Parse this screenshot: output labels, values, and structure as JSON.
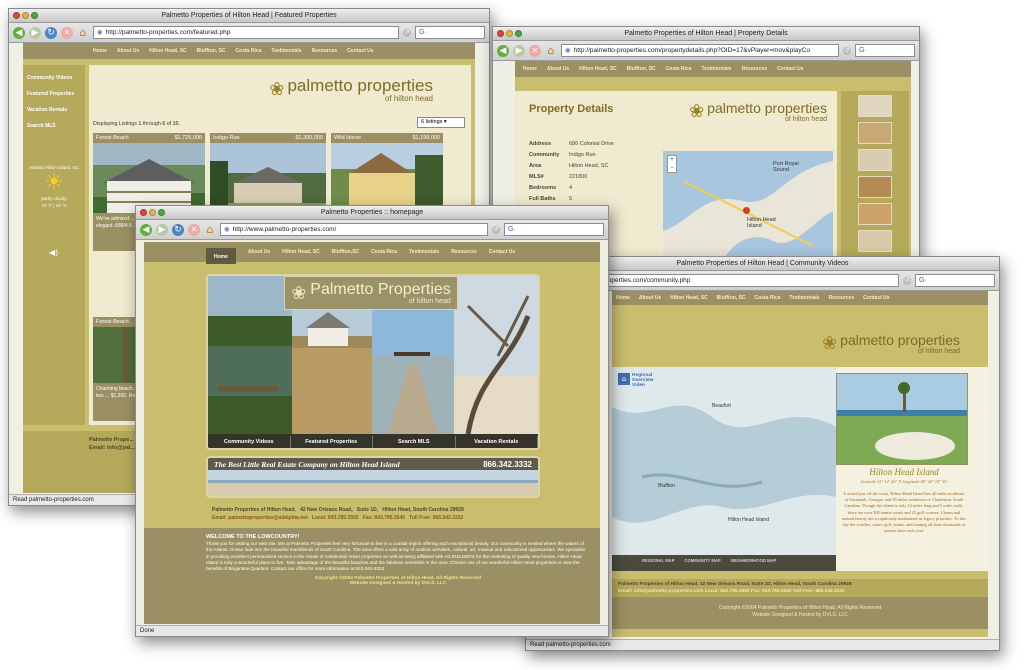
{
  "brand": {
    "name": "palmetto properties",
    "sub": "of hilton head",
    "home_title": "Palmetto Properties",
    "palm_glyph": "❀",
    "color_olive": "#c9bd6e",
    "color_nav": "#9b9063"
  },
  "nav": [
    "Home",
    "About Us",
    "Hilton Head, SC",
    "Bluffton, SC",
    "Costa Rica",
    "Testimonials",
    "Resources",
    "Contact Us"
  ],
  "nav_home": [
    "About Us",
    "Hilton Head, SC",
    "Bluffton,SC",
    "Costa Rica",
    "Testimonials",
    "Resources",
    "Contact Us"
  ],
  "nav_home_tab": "Home",
  "w1": {
    "title": "Palmetto Properties of Hilton Head | Featured Properties",
    "url": "http://palmetto-properties.com/featured.php",
    "status": "Read palmetto-properties.com",
    "sidebar": [
      "Community Videos",
      "Featured Properties",
      "Vacation Rentals",
      "Search MLS"
    ],
    "weather_title": "Atlantic Hilton Island, SC",
    "weather_label": "partly cloudy",
    "weather_temps": "74 °F | 24 °C",
    "listing_text": "Displaying Listings",
    "listing_from": "1",
    "listing_through": "through",
    "listing_to": "6",
    "listing_of": "of",
    "listing_total": "10.",
    "listings_select": "6 listings",
    "cards": [
      {
        "name": "Forest Beach",
        "price": "$1,725,000"
      },
      {
        "name": "Indigo Run",
        "price": "$1,300,000"
      },
      {
        "name": "Wild Horse",
        "price": "$1,199,000"
      }
    ],
    "card_text": "We've admired ... years with it's ... & view of ... elegant. 688/4.5 ...",
    "card2_name": "Forest Beach",
    "card2_text": "Charming beach... ocean home in ... bedroom, two ... $1,300. Room fo...",
    "footer_name": "Palmetto Prope...",
    "footer_email": "Email: info@pal..."
  },
  "w2": {
    "title": "Palmetto Properties of Hilton Head | Property Details",
    "url": "http://palmetto-properties.com/propertydetails.php?OID=17&vPlayer=mov&playCo",
    "heading": "Property Details",
    "details": [
      {
        "label": "Address",
        "value": "686 Colonial Drive"
      },
      {
        "label": "Community",
        "value": "Indigo Run"
      },
      {
        "label": "Area",
        "value": "Hilton Head, SC"
      },
      {
        "label": "MLS#",
        "value": "221800"
      },
      {
        "label": "Bedrooms",
        "value": "4"
      },
      {
        "label": "Full Baths",
        "value": "5"
      }
    ],
    "map_label_1": "Port Royal Sound",
    "map_label_2": "Hilton Head Island"
  },
  "w3": {
    "title": "Palmetto Properties :: homepage",
    "url": "http://www.palmetto-properties.com/",
    "status": "Done",
    "menu": [
      "Community Videos",
      "Featured Properties",
      "Search MLS",
      "Vacation Rentals"
    ],
    "tagline": "The Best Little Real Estate Company on Hilton Head Island",
    "phone": "866.342.3332",
    "address_line": "Palmetto Properties of Hilton Head,   42 New Orleans Road,   Suite 1D,   Hilton Head, South Carolina 29928",
    "contact_line": "Email: palmettoproperties@adelphia.net   Local: 843.785.3505   Fax: 843.785.3540   Toll Free: 866.342.3332",
    "welcome_title": "WELCOME TO THE LOWCOUNTRY!",
    "welcome_body": "Thank you for visiting our web site. We at Palmetto Properties feel very fortunate to live in a coastal region offering such exceptional beauty. Our community is nestled where the waters of the Atlantic Ocean fade into the beautiful marshlands of South Carolina. The area offers a vast array of outdoor activities, cultural, art, musical and educational opportunities. We specialize in providing excellent personalized service in the resale of residential/ resort properties as well as being affiliated with H2 BUILDERS for the marketing of quality new homes. Hilton Head Island is truly a wonderful place to live. Take advantage of the beautiful beaches and the fabulous amenities in the area. Choose one of our wonderful Hilton Head properties or view the benefits of Brigantine Quarters. Contact our office for more information at 843-342-3332.",
    "copyright": "Copyright ©2004 Palmetto Properties of Hilton Head.  All Rights Reserved",
    "credit": "Website Designed & Hosted by DVLS, LLC"
  },
  "w4": {
    "title": "Palmetto Properties of Hilton Head | Community Videos",
    "url": "http://palmetto-properties.com/community.php",
    "status": "Read palmetto-properties.com",
    "video_label": "Regional Overview Video",
    "map_places": [
      "Beaufort",
      "Bluffton",
      "Hilton Head Island"
    ],
    "map_tabs": [
      "REGIONAL MAP",
      "COMMUNITY MAP",
      "NEIGHBORHOOD MAP"
    ],
    "island_title": "Hilton Head Island",
    "coords": "(latitude 32° 12' 20\" N   longitude 80° 44' 18\" W)",
    "island_text": "Located just off the coast, Hilton Head Island lies 40 miles northeast of Savannah, Georgia, and 95 miles southwest of Charleston, South Carolina. Though the island is only 12 miles long and 5 miles wide, there are over 300 tennis courts and 25 golf courses. Charm and natural beauty are scrupulously maintained as legacy priorities. To this day the weather, water, golf, tennis, and boating all draw thousands of tourists here each year.",
    "footer_address": "Palmetto Properties of Hilton Head, 42 New Orleans Road, Suite 1D, Hilton Head, South Carolina 29928",
    "footer_contact": "Email: info@palmetto-properties.com   Local: 843.785.3505   Fax: 843.785.3540   Toll Free: 866.342.3332",
    "copyright": "Copyright ©2004 Palmetto Properties of Hilton Head. All Rights Reserved",
    "credit": "Website Designed & Hosted by DVLS, LLC"
  }
}
